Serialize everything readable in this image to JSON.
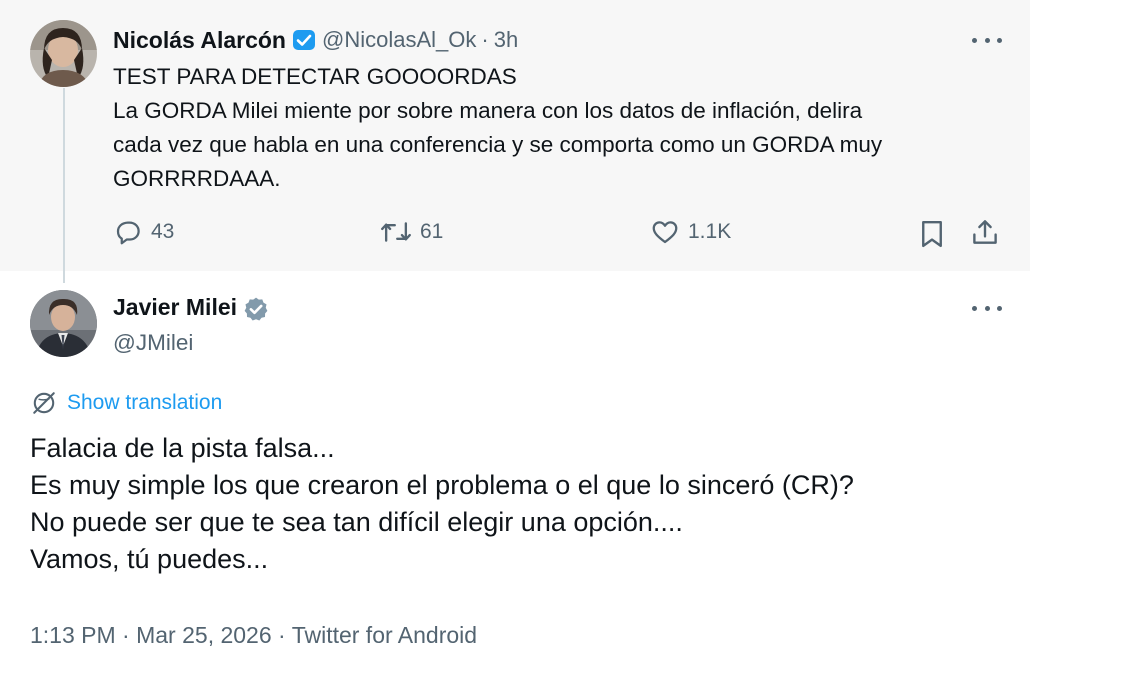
{
  "parent_tweet": {
    "author_name": "Nicolás Alarcón",
    "handle": "@NicolasAl_Ok",
    "separator": "·",
    "time": "3h",
    "text_lines": [
      "TEST PARA DETECTAR GOOOORDAS",
      "La GORDA Milei miente por sobre manera con los datos de inflación, delira",
      "cada vez que habla en una conferencia y se comporta como un GORDA muy",
      "GORRRRDAAA."
    ],
    "actions": {
      "reply_count": "43",
      "retweet_count": "61",
      "like_count": "1.1K"
    },
    "badge_color": "#1d9bf0"
  },
  "main_tweet": {
    "author_name": "Javier Milei",
    "handle": "@JMilei",
    "badge_color": "#829aab",
    "translate_label": "Show translation",
    "text_lines": [
      "Falacia de la pista falsa...",
      "Es muy simple los que crearon el problema o el que lo sinceró (CR)?",
      "No puede ser que te sea tan difícil elegir una opción....",
      "Vamos, tú puedes..."
    ],
    "meta": {
      "time": "1:13 PM",
      "separator": "·",
      "date": "Mar 25, 2026",
      "source": "Twitter for Android"
    }
  },
  "icons": {
    "reply": "reply-bubble-icon",
    "retweet": "retweet-arrows-icon",
    "like": "heart-icon",
    "bookmark": "bookmark-icon",
    "share": "share-upload-icon",
    "more": "more-dots-icon",
    "translate": "globe-icon",
    "verified": "verified-badge-icon"
  },
  "colors": {
    "link": "#1d9bf0",
    "secondary_text": "#536471",
    "parent_background": "#f7f7f7"
  }
}
